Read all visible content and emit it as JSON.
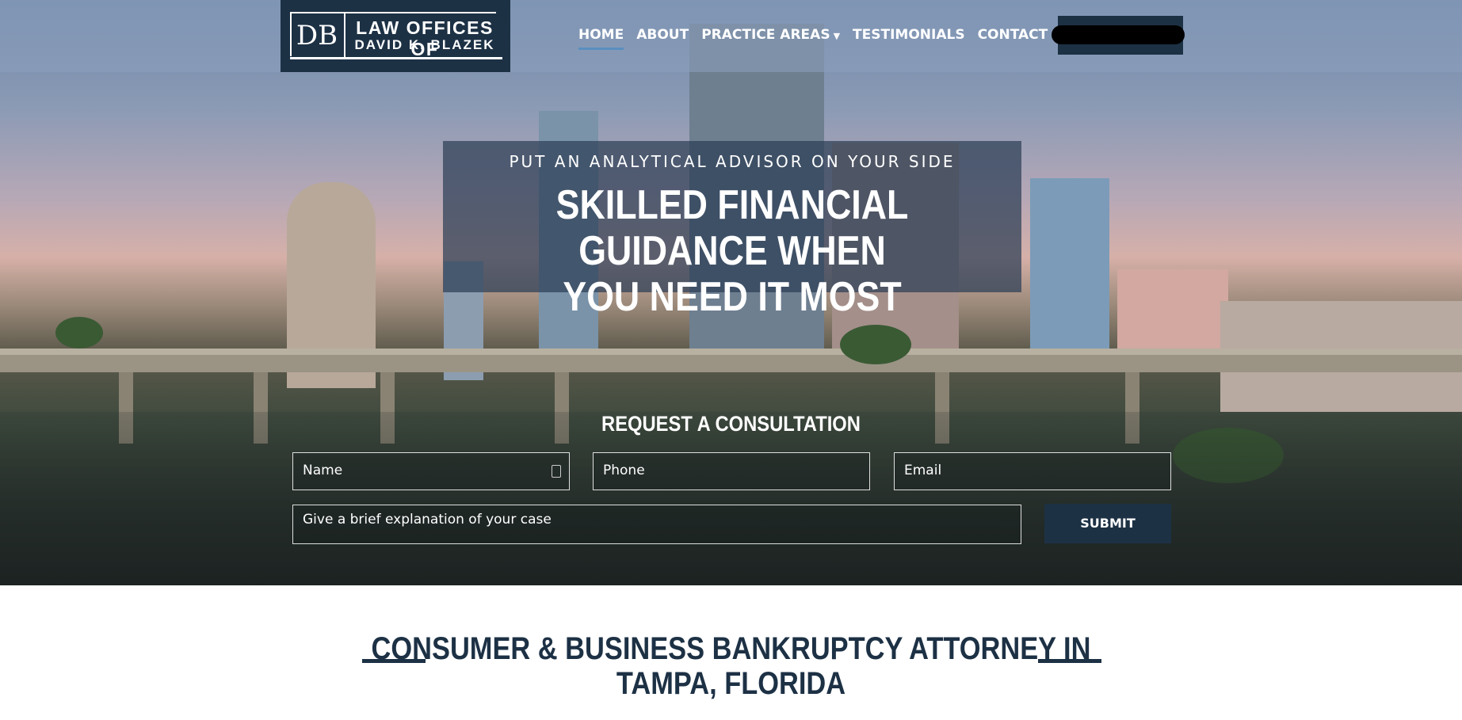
{
  "brand": {
    "monogram": "DB",
    "line1": "LAW OFFICES OF",
    "line2": "DAVID K. BLAZEK"
  },
  "nav": {
    "items": [
      {
        "label": "HOME",
        "active": true
      },
      {
        "label": "ABOUT",
        "active": false
      },
      {
        "label": "PRACTICE AREAS",
        "active": false,
        "has_dropdown": true
      },
      {
        "label": "TESTIMONIALS",
        "active": false
      },
      {
        "label": "CONTACT",
        "active": false
      }
    ],
    "dropdown_icon": "chevron-down-icon"
  },
  "hero": {
    "eyebrow": "PUT AN ANALYTICAL ADVISOR ON YOUR SIDE",
    "headline_line1": "SKILLED FINANCIAL GUIDANCE WHEN",
    "headline_line2": "YOU NEED IT MOST"
  },
  "form": {
    "title": "REQUEST A CONSULTATION",
    "name_placeholder": "Name",
    "phone_placeholder": "Phone",
    "email_placeholder": "Email",
    "message_placeholder": "Give a brief explanation of your case",
    "submit_label": "SUBMIT"
  },
  "section": {
    "title_line1": "CONSUMER & BUSINESS BANKRUPTCY ATTORNEY IN",
    "title_line2": "TAMPA, FLORIDA"
  },
  "colors": {
    "navy": "#1d3145",
    "accent": "#5a8fc0",
    "white": "#ffffff"
  }
}
